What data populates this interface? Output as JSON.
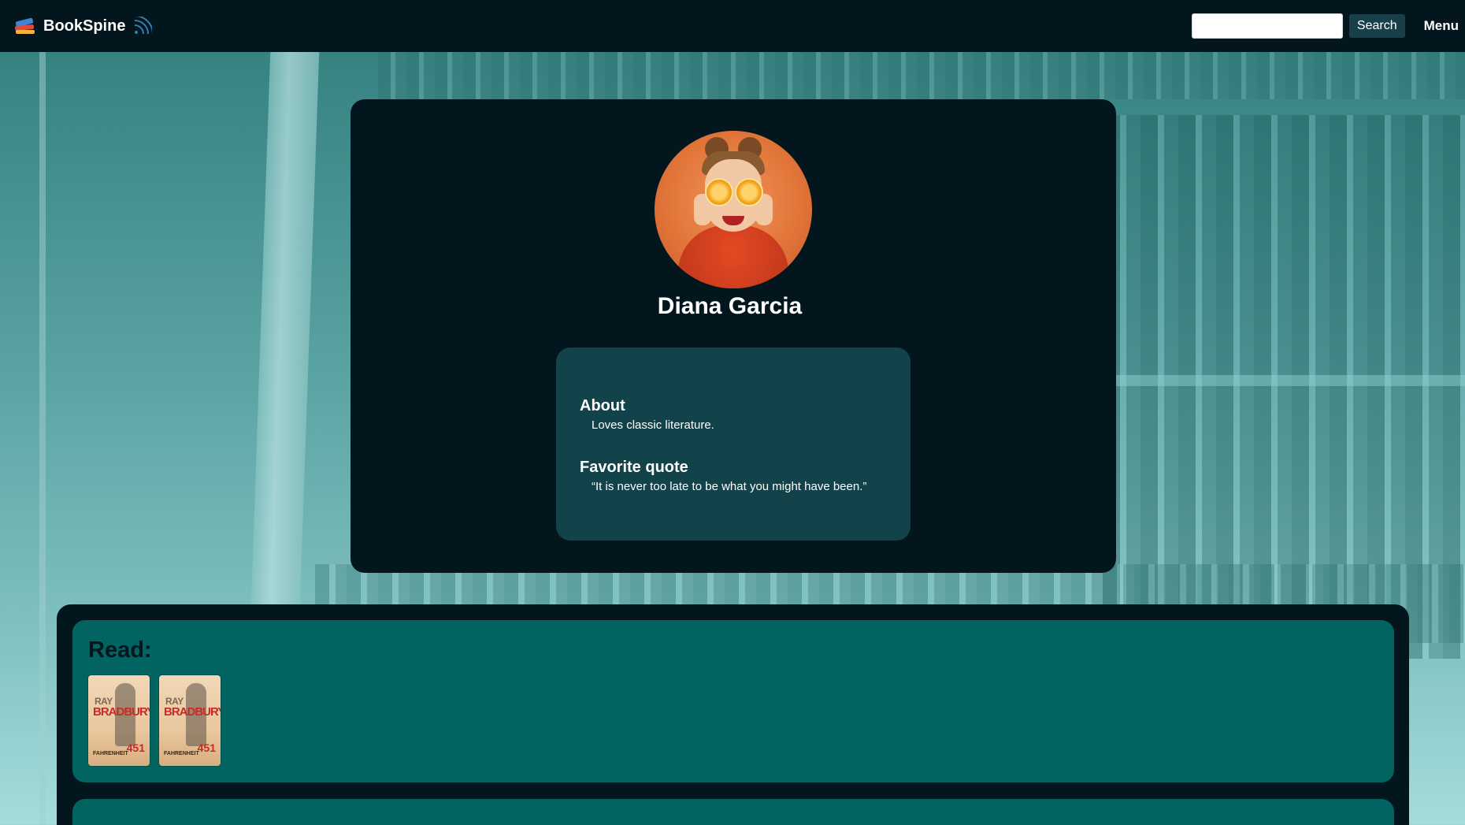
{
  "navbar": {
    "brand": "BookSpine",
    "search_placeholder": "",
    "search_label": "Search",
    "menu_label": "Menu"
  },
  "profile": {
    "name": "Diana Garcia",
    "about_heading": "About",
    "about_text": "Loves classic literature.",
    "quote_heading": "Favorite quote",
    "quote_text": "“It is never too late to be what you might have been.”"
  },
  "shelves": {
    "read_title": "Read:",
    "read_books": [
      {
        "author_first": "RAY",
        "author_last": "BRADBURY",
        "title": "FAHRENHEIT",
        "number": "451"
      },
      {
        "author_first": "RAY",
        "author_last": "BRADBURY",
        "title": "FAHRENHEIT",
        "number": "451"
      }
    ]
  },
  "colors": {
    "navbar_bg": "#03161e",
    "card_bg": "#03161e",
    "info_box_bg": "#12424a",
    "shelf_panel_bg": "#026461",
    "search_button_bg": "#17404a"
  },
  "icons": {
    "brand": "books-stack-icon",
    "feed": "rss-icon"
  }
}
